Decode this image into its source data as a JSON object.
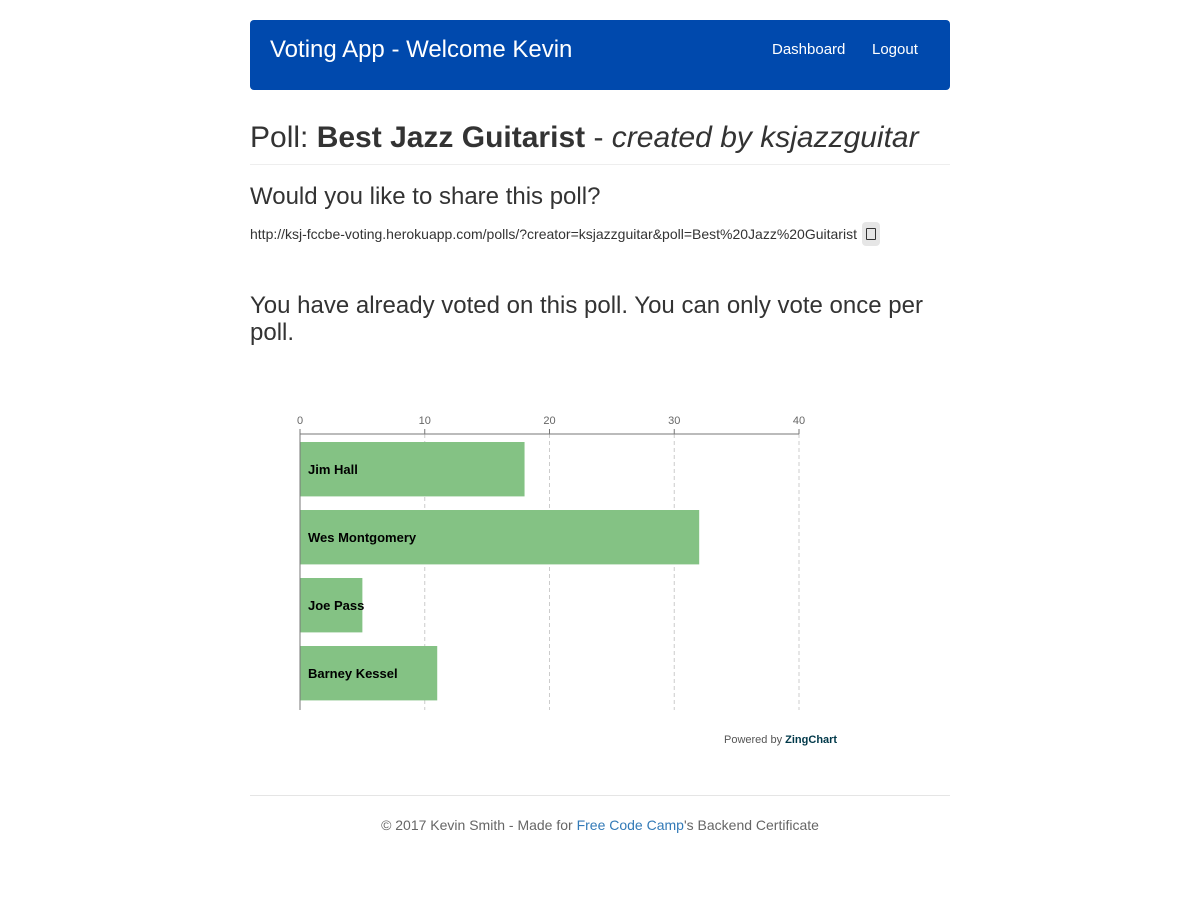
{
  "navbar": {
    "brand": "Voting App - Welcome Kevin",
    "links": [
      {
        "label": "Dashboard"
      },
      {
        "label": "Logout"
      }
    ],
    "color": "#0049ad"
  },
  "poll": {
    "prefix": "Poll: ",
    "name": "Best Jazz Guitarist",
    "separator": " - ",
    "created_by": "created by ksjazzguitar"
  },
  "share": {
    "heading": "Would you like to share this poll?",
    "url": "http://ksj-fccbe-voting.herokuapp.com/polls/?creator=ksjazzguitar&poll=Best%20Jazz%20Guitarist",
    "copy_icon": "copy-icon"
  },
  "voted_message": "You have already voted on this poll. You can only vote once per poll.",
  "chart_data": {
    "type": "bar",
    "orientation": "horizontal",
    "categories": [
      "Jim Hall",
      "Wes Montgomery",
      "Joe Pass",
      "Barney Kessel"
    ],
    "values": [
      18,
      32,
      5,
      11
    ],
    "xlim": [
      0,
      40
    ],
    "ticks": [
      0,
      10,
      20,
      30,
      40
    ],
    "grid": true,
    "bar_color": "#84c284"
  },
  "powered_by": {
    "prefix": "Powered by ",
    "brand": "ZingChart"
  },
  "footer": {
    "prefix": "© 2017 Kevin Smith - Made for ",
    "link": "Free Code Camp",
    "suffix": "'s Backend Certificate"
  }
}
